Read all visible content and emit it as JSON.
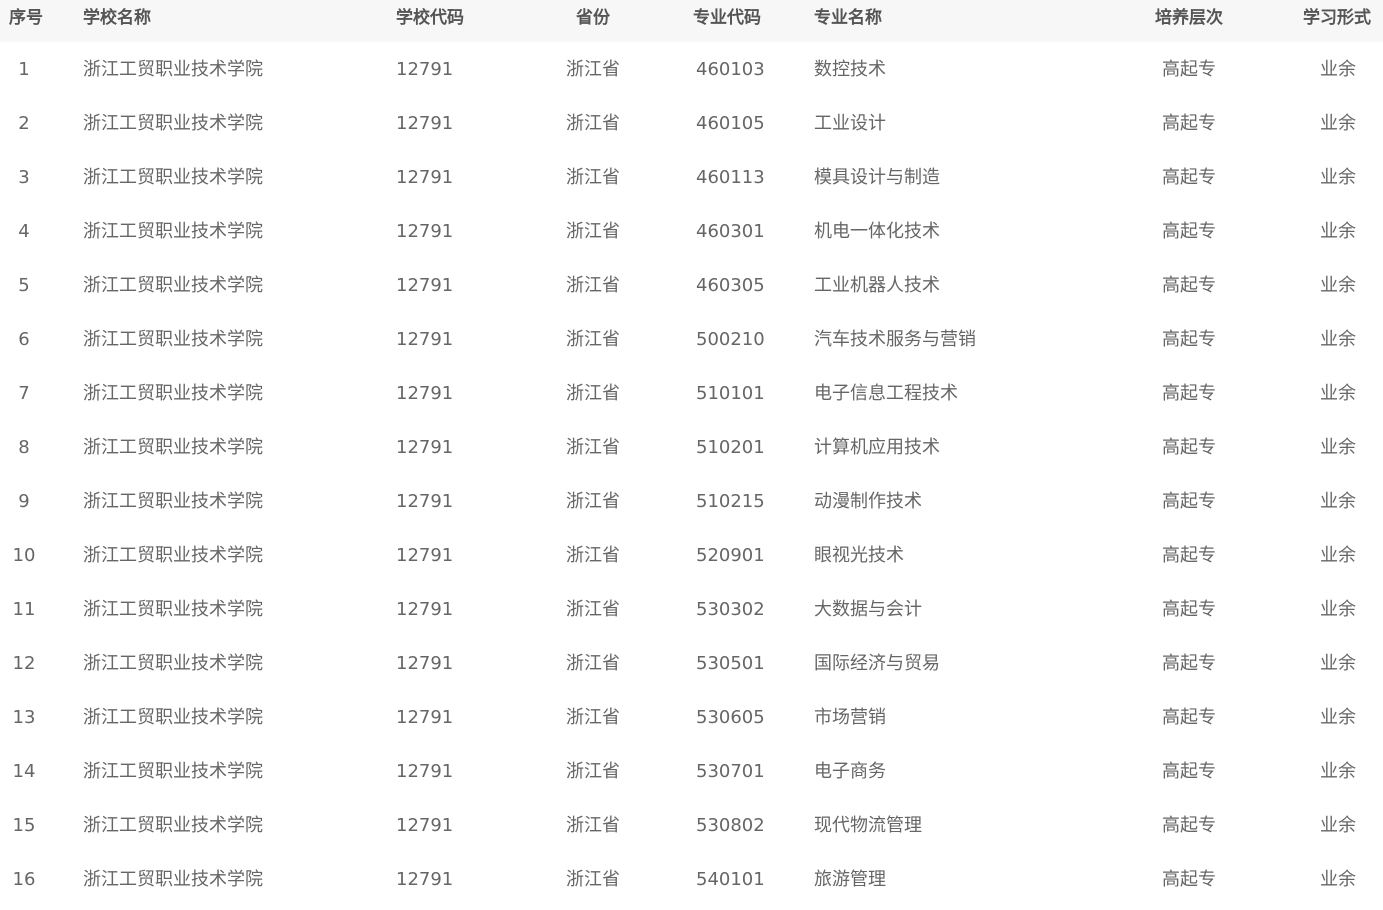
{
  "table": {
    "headers": {
      "index": "序号",
      "school_name": "学校名称",
      "school_code": "学校代码",
      "province": "省份",
      "major_code": "专业代码",
      "major_name": "专业名称",
      "level": "培养层次",
      "study_form": "学习形式"
    },
    "rows": [
      {
        "index": "1",
        "school_name": "浙江工贸职业技术学院",
        "school_code": "12791",
        "province": "浙江省",
        "major_code": "460103",
        "major_name": "数控技术",
        "level": "高起专",
        "study_form": "业余"
      },
      {
        "index": "2",
        "school_name": "浙江工贸职业技术学院",
        "school_code": "12791",
        "province": "浙江省",
        "major_code": "460105",
        "major_name": "工业设计",
        "level": "高起专",
        "study_form": "业余"
      },
      {
        "index": "3",
        "school_name": "浙江工贸职业技术学院",
        "school_code": "12791",
        "province": "浙江省",
        "major_code": "460113",
        "major_name": "模具设计与制造",
        "level": "高起专",
        "study_form": "业余"
      },
      {
        "index": "4",
        "school_name": "浙江工贸职业技术学院",
        "school_code": "12791",
        "province": "浙江省",
        "major_code": "460301",
        "major_name": "机电一体化技术",
        "level": "高起专",
        "study_form": "业余"
      },
      {
        "index": "5",
        "school_name": "浙江工贸职业技术学院",
        "school_code": "12791",
        "province": "浙江省",
        "major_code": "460305",
        "major_name": "工业机器人技术",
        "level": "高起专",
        "study_form": "业余"
      },
      {
        "index": "6",
        "school_name": "浙江工贸职业技术学院",
        "school_code": "12791",
        "province": "浙江省",
        "major_code": "500210",
        "major_name": "汽车技术服务与营销",
        "level": "高起专",
        "study_form": "业余"
      },
      {
        "index": "7",
        "school_name": "浙江工贸职业技术学院",
        "school_code": "12791",
        "province": "浙江省",
        "major_code": "510101",
        "major_name": "电子信息工程技术",
        "level": "高起专",
        "study_form": "业余"
      },
      {
        "index": "8",
        "school_name": "浙江工贸职业技术学院",
        "school_code": "12791",
        "province": "浙江省",
        "major_code": "510201",
        "major_name": "计算机应用技术",
        "level": "高起专",
        "study_form": "业余"
      },
      {
        "index": "9",
        "school_name": "浙江工贸职业技术学院",
        "school_code": "12791",
        "province": "浙江省",
        "major_code": "510215",
        "major_name": "动漫制作技术",
        "level": "高起专",
        "study_form": "业余"
      },
      {
        "index": "10",
        "school_name": "浙江工贸职业技术学院",
        "school_code": "12791",
        "province": "浙江省",
        "major_code": "520901",
        "major_name": "眼视光技术",
        "level": "高起专",
        "study_form": "业余"
      },
      {
        "index": "11",
        "school_name": "浙江工贸职业技术学院",
        "school_code": "12791",
        "province": "浙江省",
        "major_code": "530302",
        "major_name": "大数据与会计",
        "level": "高起专",
        "study_form": "业余"
      },
      {
        "index": "12",
        "school_name": "浙江工贸职业技术学院",
        "school_code": "12791",
        "province": "浙江省",
        "major_code": "530501",
        "major_name": "国际经济与贸易",
        "level": "高起专",
        "study_form": "业余"
      },
      {
        "index": "13",
        "school_name": "浙江工贸职业技术学院",
        "school_code": "12791",
        "province": "浙江省",
        "major_code": "530605",
        "major_name": "市场营销",
        "level": "高起专",
        "study_form": "业余"
      },
      {
        "index": "14",
        "school_name": "浙江工贸职业技术学院",
        "school_code": "12791",
        "province": "浙江省",
        "major_code": "530701",
        "major_name": "电子商务",
        "level": "高起专",
        "study_form": "业余"
      },
      {
        "index": "15",
        "school_name": "浙江工贸职业技术学院",
        "school_code": "12791",
        "province": "浙江省",
        "major_code": "530802",
        "major_name": "现代物流管理",
        "level": "高起专",
        "study_form": "业余"
      },
      {
        "index": "16",
        "school_name": "浙江工贸职业技术学院",
        "school_code": "12791",
        "province": "浙江省",
        "major_code": "540101",
        "major_name": "旅游管理",
        "level": "高起专",
        "study_form": "业余"
      }
    ]
  }
}
